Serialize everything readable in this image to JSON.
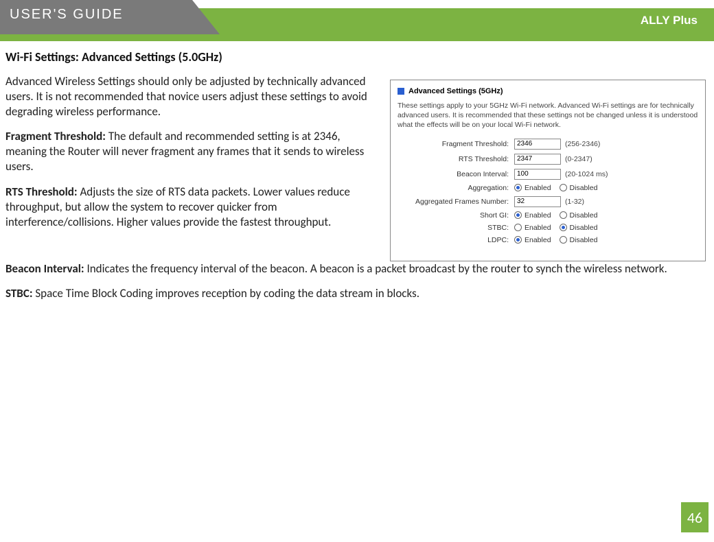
{
  "header": {
    "guide_label": "USER'S GUIDE",
    "brand": "ALLY Plus"
  },
  "page": {
    "title": "Wi-Fi Settings: Advanced Settings (5.0GHz)",
    "intro": "Advanced Wireless Settings should only be adjusted by technically advanced users. It is not recommended that novice users adjust these settings to avoid degrading wireless performance.",
    "fragment_label": "Fragment Threshold:",
    "fragment_text": " The default and recommended setting is at 2346, meaning the Router will never fragment any frames that it sends to wireless users.",
    "rts_label": "RTS Threshold:",
    "rts_text": " Adjusts the size of RTS data packets. Lower values reduce throughput, but allow the system to recover quicker from interference/collisions. Higher values provide the fastest throughput.",
    "beacon_label": "Beacon Interval:",
    "beacon_text": " Indicates the frequency interval of the beacon. A beacon is a packet broadcast by the router to synch the wireless network.",
    "stbc_label": "STBC:",
    "stbc_text": " Space Time Block Coding improves reception by coding the data stream in blocks.",
    "page_number": "46"
  },
  "panel": {
    "title": "Advanced Settings (5GHz)",
    "desc": "These settings apply to your 5GHz Wi-Fi network. Advanced Wi-Fi settings are for technically advanced users. It is recommended that these settings not be changed unless it is understood what the effects will be on your local Wi-Fi network.",
    "rows": {
      "fragment": {
        "label": "Fragment Threshold:",
        "value": "2346",
        "range": "(256-2346)"
      },
      "rts": {
        "label": "RTS Threshold:",
        "value": "2347",
        "range": "(0-2347)"
      },
      "beacon": {
        "label": "Beacon Interval:",
        "value": "100",
        "range": "(20-1024 ms)"
      },
      "aggregation": {
        "label": "Aggregation:",
        "enabled": "Enabled",
        "disabled": "Disabled",
        "selected": "enabled"
      },
      "aggframes": {
        "label": "Aggregated Frames Number:",
        "value": "32",
        "range": "(1-32)"
      },
      "shortgi": {
        "label": "Short GI:",
        "enabled": "Enabled",
        "disabled": "Disabled",
        "selected": "enabled"
      },
      "stbc": {
        "label": "STBC:",
        "enabled": "Enabled",
        "disabled": "Disabled",
        "selected": "disabled"
      },
      "ldpc": {
        "label": "LDPC:",
        "enabled": "Enabled",
        "disabled": "Disabled",
        "selected": "enabled"
      }
    }
  }
}
